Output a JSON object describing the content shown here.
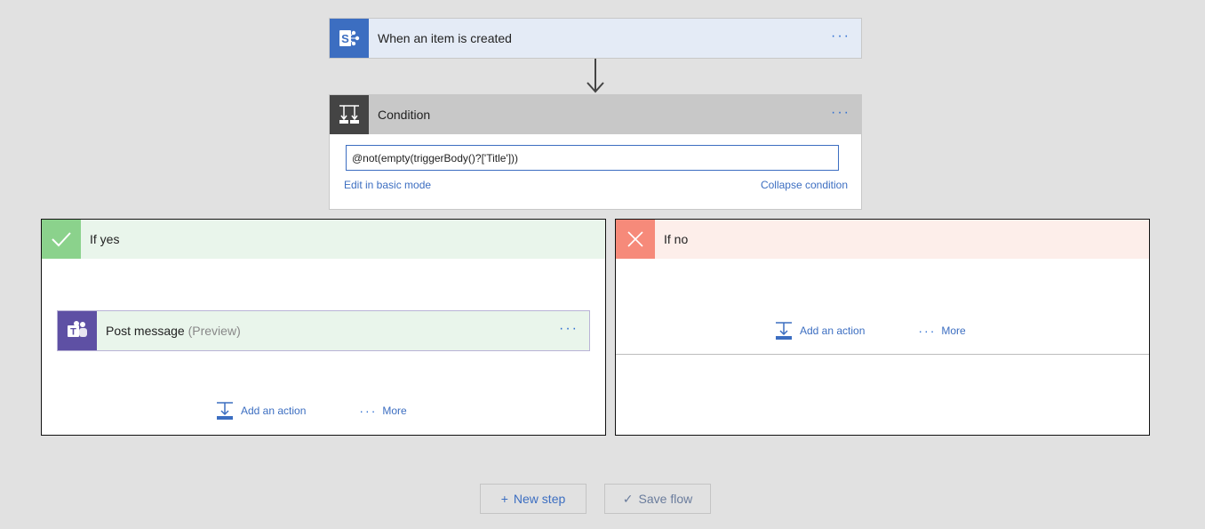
{
  "trigger": {
    "title": "When an item is created",
    "icon": "sharepoint-icon",
    "more": "···"
  },
  "condition": {
    "title": "Condition",
    "icon": "condition-icon",
    "more": "···",
    "expression": "@not(empty(triggerBody()?['Title']))",
    "edit_basic_label": "Edit in basic mode",
    "collapse_label": "Collapse condition"
  },
  "branch_yes": {
    "title": "If yes",
    "icon": "checkmark-icon",
    "action": {
      "title": "Post message",
      "suffix": "(Preview)",
      "icon": "teams-icon",
      "more": "···"
    },
    "add_action_label": "Add an action",
    "more_dots": "···",
    "more_label": "More"
  },
  "branch_no": {
    "title": "If no",
    "icon": "close-icon",
    "add_action_label": "Add an action",
    "more_dots": "···",
    "more_label": "More"
  },
  "footer": {
    "new_step_glyph": "+",
    "new_step_label": "New step",
    "save_glyph": "✓",
    "save_label": "Save flow"
  },
  "colors": {
    "accent": "#3c6ec1",
    "background": "#e1e1e1",
    "yes": "#8bd28c",
    "no": "#f68a7a",
    "teams": "#5e50a4"
  }
}
